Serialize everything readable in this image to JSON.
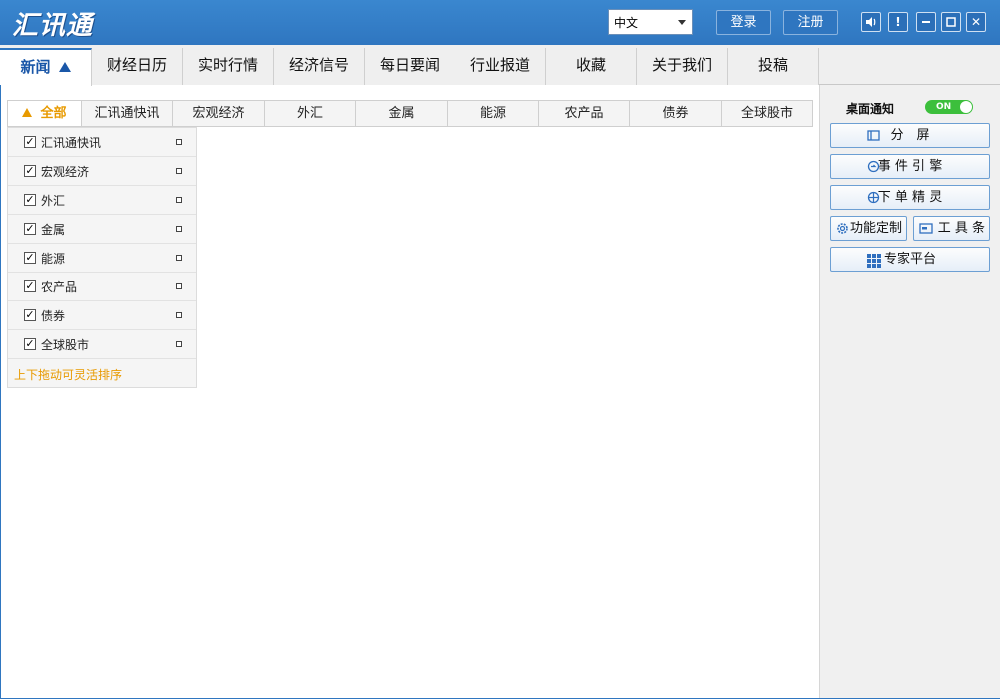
{
  "app": {
    "logo": "汇讯通"
  },
  "titlebar": {
    "language": "中文",
    "login": "登录",
    "register": "注册",
    "icons": {
      "volume": "volume-icon",
      "alert": "exclamation-icon",
      "minimize": "minimize-icon",
      "maximize": "maximize-icon",
      "close": "close-icon"
    }
  },
  "tabs": [
    "新闻",
    "财经日历",
    "实时行情",
    "经济信号",
    "每日要闻",
    "行业报道",
    "收藏",
    "关于我们",
    "投稿"
  ],
  "categories": [
    "全部",
    "汇讯通快讯",
    "宏观经济",
    "外汇",
    "金属",
    "能源",
    "农产品",
    "债券",
    "全球股市"
  ],
  "filters": [
    {
      "label": "汇讯通快讯",
      "checked": true
    },
    {
      "label": "宏观经济",
      "checked": true
    },
    {
      "label": "外汇",
      "checked": true
    },
    {
      "label": "金属",
      "checked": true
    },
    {
      "label": "能源",
      "checked": true
    },
    {
      "label": "农产品",
      "checked": true
    },
    {
      "label": "债券",
      "checked": true
    },
    {
      "label": "全球股市",
      "checked": true
    }
  ],
  "filter_hint": "上下拖动可灵活排序",
  "right": {
    "notify_label": "桌面通知",
    "notify_state": "ON",
    "buttons": {
      "split": "分　屏",
      "event": "事 件 引 擎",
      "order": "下 单 精 灵",
      "custom": "功能定制",
      "toolbar": "工 具 条",
      "expert": "专家平台"
    }
  },
  "colors": {
    "brand": "#2f76c0",
    "accent": "#e89a00",
    "toggle_on": "#3cbf3c"
  }
}
